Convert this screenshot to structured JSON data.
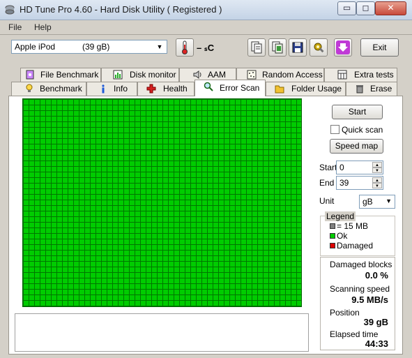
{
  "window": {
    "title": "HD Tune Pro 4.60 - Hard Disk Utility (  Registered )",
    "min": "▭",
    "max": "◻",
    "close": "✕"
  },
  "menu": {
    "file": "File",
    "help": "Help"
  },
  "toolbar": {
    "drive": "Apple  iPod",
    "drive_size": "(39 gB)",
    "temperature": "– ₛC",
    "exit_label": "Exit",
    "icons": [
      "copy-info-icon",
      "copy-screenshot-icon",
      "save-icon",
      "options-icon",
      "download-icon"
    ]
  },
  "tabs_top": [
    "File Benchmark",
    "Disk monitor",
    "AAM",
    "Random Access",
    "Extra tests"
  ],
  "tabs_bottom": [
    "Benchmark",
    "Info",
    "Health",
    "Error Scan",
    "Folder Usage",
    "Erase"
  ],
  "active_tab": "Error Scan",
  "controls": {
    "start_button": "Start",
    "quick_scan_label": "Quick scan",
    "quick_scan_checked": false,
    "speed_map_button": "Speed map",
    "start_label": "Start",
    "start_value": "0",
    "end_label": "End",
    "end_value": "39",
    "unit_label": "Unit",
    "unit_value": "gB"
  },
  "legend": {
    "title": "Legend",
    "items": [
      {
        "label": "= 15 MB",
        "color": "#808080"
      },
      {
        "label": "Ok",
        "color": "#00cc00"
      },
      {
        "label": "Damaged",
        "color": "#dd0000"
      }
    ]
  },
  "stats": {
    "damaged_blocks_label": "Damaged blocks",
    "damaged_blocks_value": "0.0 %",
    "scanning_speed_label": "Scanning speed",
    "scanning_speed_value": "9.5 MB/s",
    "position_label": "Position",
    "position_value": "39 gB",
    "elapsed_label": "Elapsed time",
    "elapsed_value": "44:33"
  },
  "scan_map": {
    "status": "all blocks ok",
    "color": "#00cc00"
  }
}
